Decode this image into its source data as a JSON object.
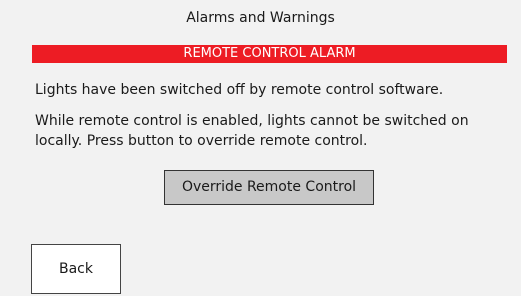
{
  "header": {
    "title": "Alarms and Warnings"
  },
  "alarm": {
    "banner": "REMOTE CONTROL ALARM",
    "color": "#ed1c24",
    "message_1": "Lights have been switched off by remote control software.",
    "message_2": "While remote control is enabled, lights cannot be switched on locally. Press button to override remote control."
  },
  "actions": {
    "override_label": "Override Remote Control",
    "back_label": "Back"
  }
}
